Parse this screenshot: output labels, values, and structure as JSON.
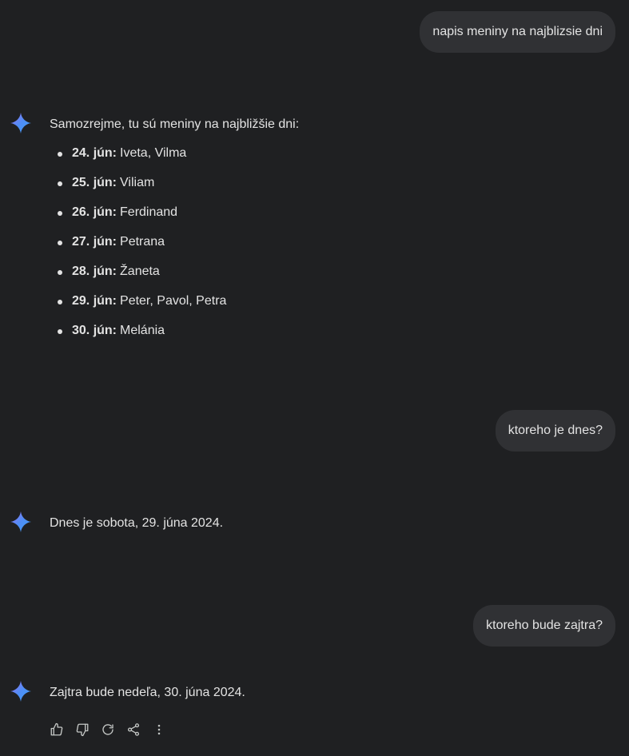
{
  "conversation": {
    "user_messages": [
      {
        "text": "napis meniny na najblizsie dni"
      },
      {
        "text": "ktoreho je dnes?"
      },
      {
        "text": "ktoreho bude zajtra?"
      }
    ],
    "responses": [
      {
        "intro": "Samozrejme, tu sú meniny na najbližšie dni:",
        "list": [
          {
            "date": "24. jún:",
            "names": "Iveta, Vilma"
          },
          {
            "date": "25. jún:",
            "names": "Viliam"
          },
          {
            "date": "26. jún:",
            "names": "Ferdinand"
          },
          {
            "date": "27. jún:",
            "names": "Petrana"
          },
          {
            "date": "28. jún:",
            "names": "Žaneta"
          },
          {
            "date": "29. jún:",
            "names": "Peter, Pavol, Petra"
          },
          {
            "date": "30. jún:",
            "names": "Melánia"
          }
        ]
      },
      {
        "text": "Dnes je sobota, 29. júna 2024."
      },
      {
        "text": "Zajtra bude nedeľa, 30. júna 2024."
      }
    ]
  },
  "actions": [
    {
      "icon": "thumb-up-icon"
    },
    {
      "icon": "thumb-down-icon"
    },
    {
      "icon": "refresh-icon"
    },
    {
      "icon": "share-icon"
    },
    {
      "icon": "more-vertical-icon"
    }
  ],
  "colors": {
    "background": "#1f2022",
    "bubble": "#303134",
    "text": "#e3e3e3",
    "spark_blue": "#4f8df5"
  }
}
